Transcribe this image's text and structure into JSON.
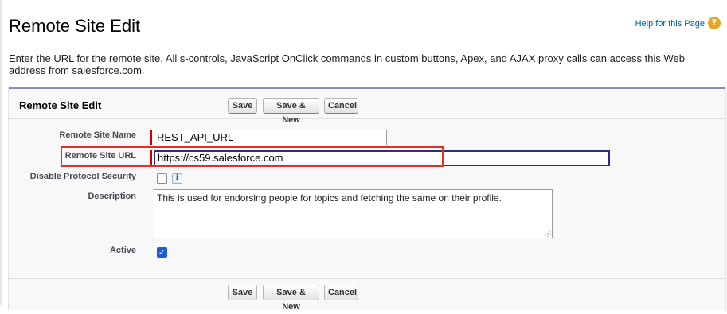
{
  "page": {
    "title": "Remote Site Edit",
    "help_link": "Help for this Page",
    "help_icon": "question-circle-icon",
    "intro": "Enter the URL for the remote site. All s-controls, JavaScript OnClick commands in custom buttons, Apex, and AJAX proxy calls can access this Web address from salesforce.com."
  },
  "block": {
    "title": "Remote Site Edit",
    "buttons": {
      "save": "Save",
      "save_new": "Save & New",
      "cancel": "Cancel"
    }
  },
  "fields": {
    "name": {
      "label": "Remote Site Name",
      "value": "REST_API_URL",
      "required": true
    },
    "url": {
      "label": "Remote Site URL",
      "value": "https://cs59.salesforce.com",
      "required": true
    },
    "disable_protocol": {
      "label": "Disable Protocol Security",
      "checked": false,
      "info_icon": "info-icon",
      "info_glyph": "i"
    },
    "description": {
      "label": "Description",
      "value": "This is used for endorsing people for topics and fetching the same on their profile."
    },
    "active": {
      "label": "Active",
      "checked": true,
      "check_glyph": "✓"
    }
  },
  "colors": {
    "accent": "#2b2d8c",
    "highlight": "#e0321e",
    "required": "#cc0000",
    "checkbox": "#1f5cd6"
  }
}
